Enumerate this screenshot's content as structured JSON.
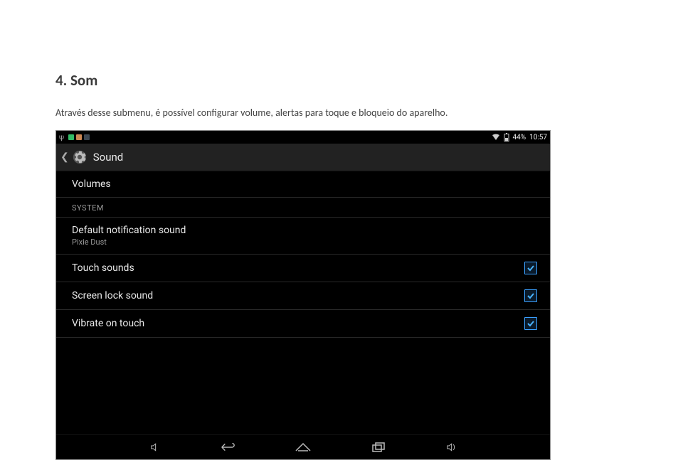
{
  "document": {
    "heading": "4. Som",
    "paragraph": "Através desse submenu, é possível configurar volume, alertas para toque e bloqueio do aparelho."
  },
  "statusbar": {
    "battery_percent": "44%",
    "clock": "10:57"
  },
  "actionbar": {
    "title": "Sound"
  },
  "settings": {
    "volumes_label": "Volumes",
    "section_system": "SYSTEM",
    "notification": {
      "title": "Default notification sound",
      "value": "Pixie Dust"
    },
    "touch_sounds_label": "Touch sounds",
    "screen_lock_label": "Screen lock sound",
    "vibrate_label": "Vibrate on touch"
  }
}
